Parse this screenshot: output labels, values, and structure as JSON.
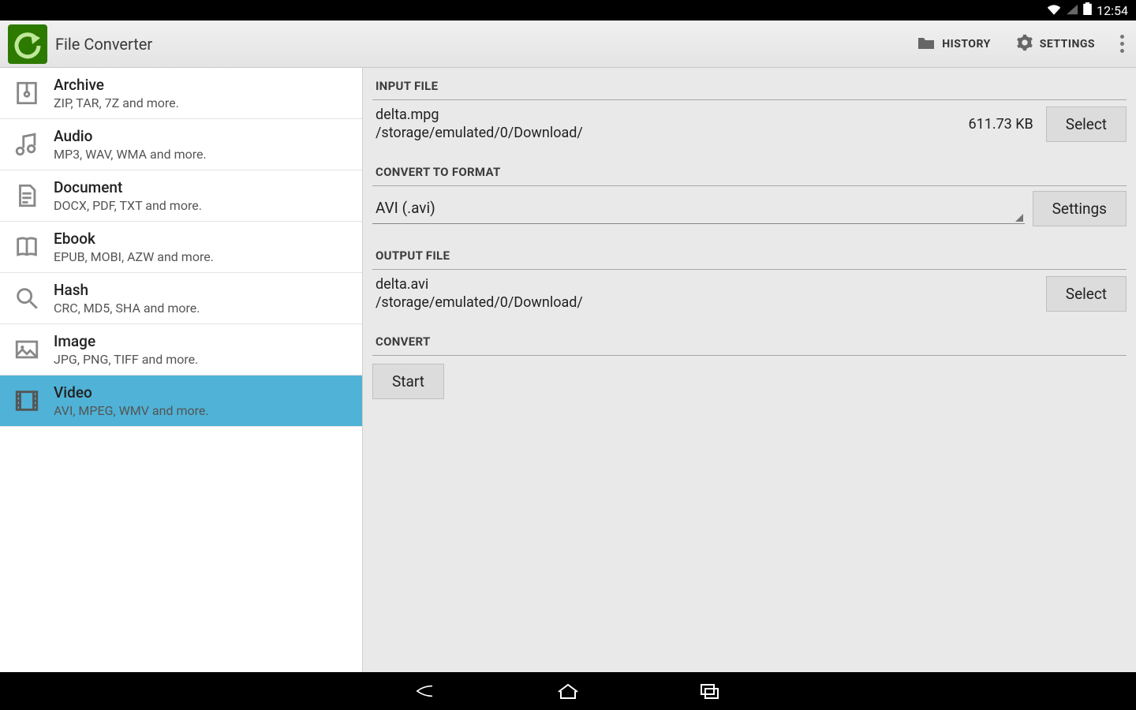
{
  "statusbar": {
    "time": "12:54"
  },
  "actionbar": {
    "title": "File Converter",
    "history_label": "HISTORY",
    "settings_label": "SETTINGS"
  },
  "sidebar": {
    "items": [
      {
        "title": "Archive",
        "sub": "ZIP, TAR, 7Z and more.",
        "icon": "archive"
      },
      {
        "title": "Audio",
        "sub": "MP3, WAV, WMA and more.",
        "icon": "audio"
      },
      {
        "title": "Document",
        "sub": "DOCX, PDF, TXT and more.",
        "icon": "document"
      },
      {
        "title": "Ebook",
        "sub": "EPUB, MOBI, AZW and more.",
        "icon": "ebook"
      },
      {
        "title": "Hash",
        "sub": "CRC, MD5, SHA and more.",
        "icon": "hash"
      },
      {
        "title": "Image",
        "sub": "JPG, PNG, TIFF and more.",
        "icon": "image"
      },
      {
        "title": "Video",
        "sub": "AVI, MPEG, WMV and more.",
        "icon": "video",
        "selected": true
      }
    ]
  },
  "main": {
    "section_input_label": "INPUT FILE",
    "input_file": {
      "name": "delta.mpg",
      "path": "/storage/emulated/0/Download/",
      "size": "611.73 KB"
    },
    "select_label": "Select",
    "section_format_label": "CONVERT TO FORMAT",
    "format_value": "AVI (.avi)",
    "format_settings_label": "Settings",
    "section_output_label": "OUTPUT FILE",
    "output_file": {
      "name": "delta.avi",
      "path": "/storage/emulated/0/Download/"
    },
    "section_convert_label": "CONVERT",
    "start_label": "Start"
  }
}
